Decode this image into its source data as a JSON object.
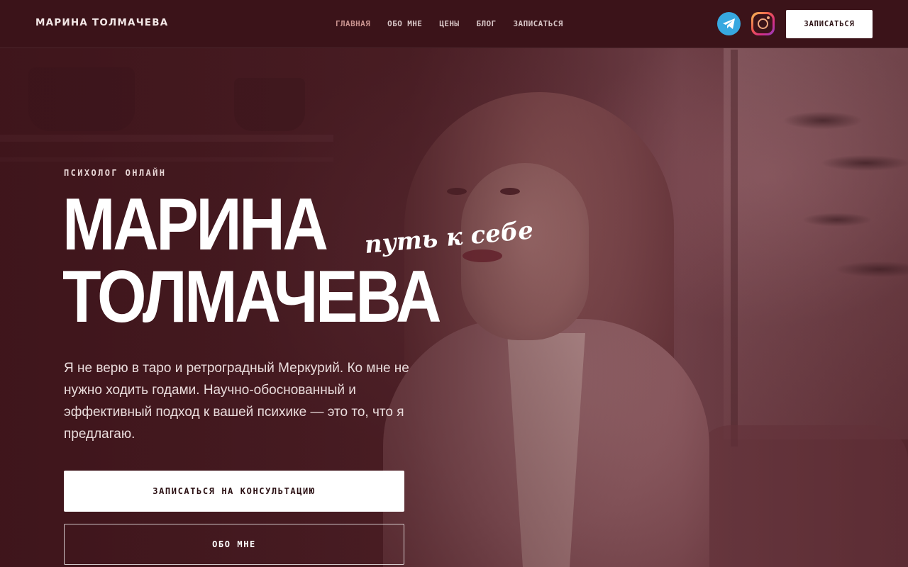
{
  "header": {
    "brand": "МАРИНА ТОЛМАЧЕВА",
    "nav": [
      {
        "label": "ГЛАВНАЯ",
        "active": true
      },
      {
        "label": "ОБО МНЕ",
        "active": false
      },
      {
        "label": "ЦЕНЫ",
        "active": false
      },
      {
        "label": "БЛОГ",
        "active": false
      },
      {
        "label": "ЗАПИСАТЬСЯ",
        "active": false
      }
    ],
    "social": [
      {
        "icon": "telegram-icon",
        "color": "#37a8e0"
      },
      {
        "icon": "instagram-icon",
        "color": "#d62f86"
      }
    ],
    "cta_label": "ЗАПИСАТЬСЯ"
  },
  "hero": {
    "eyebrow": "ПСИХОЛОГ ОНЛАЙН",
    "title_line1": "МАРИНА",
    "title_line2": "ТОЛМАЧЕВА",
    "script_tagline": "путь к себе",
    "description": "Я не верю в таро и ретроградный Меркурий. Ко мне не нужно ходить годами. Научно-обоснованный и эффективный подход к вашей психике — это то, что я предлагаю.",
    "primary_button": "ЗАПИСАТЬСЯ НА КОНСУЛЬТАЦИЮ",
    "secondary_button": "ОБО МНЕ"
  },
  "colors": {
    "header_bg": "#3b1319",
    "overlay": "#3a1218",
    "active_nav": "#c9938f",
    "button_bg": "#ffffff"
  }
}
